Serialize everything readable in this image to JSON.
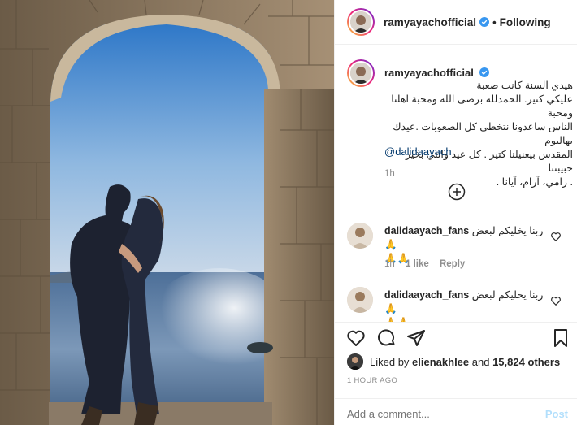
{
  "post": {
    "username": "ramyayachofficial",
    "follow_status": "Following",
    "caption_lines": [
      "هيدي السنة كانت صعبة",
      "عليكي كتير. الحمدلله برضى الله ومحبة اهلنا ومحبة",
      "الناس ساعدونا نتخطى كل الصعوبات .عيدك بهاليوم",
      "المقدس بيعنيلنا كتير . كل عيد وانتي بخير حبيبتنا",
      ". رامي، آرام، آيانا ."
    ],
    "mention": "@dalidaayach",
    "caption_time": "1h",
    "load_more_icon": "plus-circle-icon"
  },
  "comments": [
    {
      "username": "dalidaayach_fans",
      "text": "ربنا يخليكم لبعض 🙏",
      "emoji": "🙏🙏",
      "time": "1h",
      "likes": "1 like",
      "reply": "Reply"
    },
    {
      "username": "dalidaayach_fans",
      "text": "ربنا يخليكم لبعض 🙏",
      "emoji": "🙏🙏",
      "time": "",
      "likes": "",
      "reply": ""
    }
  ],
  "actions": {
    "icons": [
      "heart-icon",
      "comment-icon",
      "share-icon",
      "bookmark-icon"
    ]
  },
  "likes": {
    "prefix": "Liked by ",
    "user": "elienakhlee",
    "middle": " and ",
    "count": "15,824 others"
  },
  "timestamp": "1 HOUR AGO",
  "add_comment": {
    "placeholder": "Add a comment...",
    "post_label": "Post"
  },
  "colors": {
    "verified": "#3897f0",
    "link": "#00376b",
    "muted": "#8e8e8e",
    "post_disabled": "#b2dffc"
  }
}
